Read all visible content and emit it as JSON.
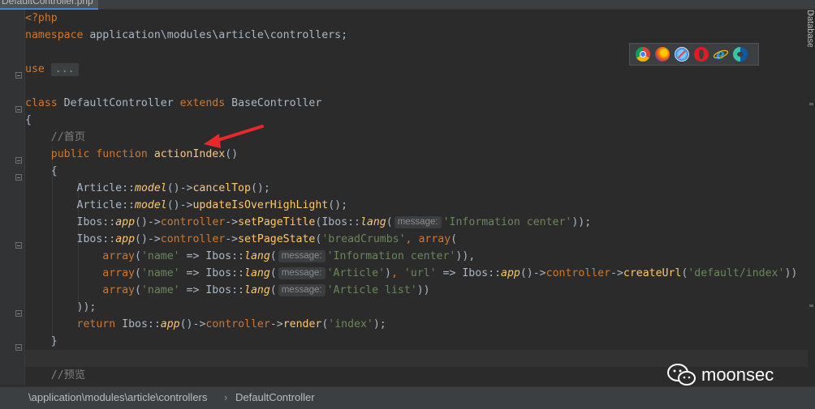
{
  "file_tab": {
    "label": "DefaultController.php"
  },
  "side_panel": {
    "label": "Database"
  },
  "code": {
    "php_open": "<?php",
    "namespace_kw": "namespace",
    "namespace_path": "application\\modules\\article\\controllers;",
    "use_kw": "use",
    "use_folded": "...",
    "class_kw": "class",
    "class_name": "DefaultController",
    "extends_kw": "extends",
    "parent_class": "BaseController",
    "brace_open": "{",
    "brace_close": "}",
    "comment_home": "//首页",
    "public_kw": "public",
    "function_kw": "function",
    "method_name": "actionIndex",
    "method_parens": "()",
    "article_cls": "Article",
    "dcolon": "::",
    "model_fn": "model",
    "arrow": "->",
    "cancel_top": "cancelTop",
    "update_over": "updateIsOverHighLight",
    "call_end": "();",
    "paren_open": "(",
    "paren_close": ")",
    "ibos_cls": "Ibos",
    "app_fn": "app",
    "controller_prop": "controller",
    "set_title_fn": "setPageTitle",
    "lang_fn": "lang",
    "hint_message": "message:",
    "str_info_center": "'Information center'",
    "close_2": "));",
    "set_state_fn": "setPageState",
    "str_breadcrumbs": "'breadCrumbs'",
    "comma": ", ",
    "array_kw": "array",
    "str_name": "'name'",
    "fat_arrow": " => ",
    "close_comma": ")),",
    "str_article": "'Article'",
    "str_url": "'url'",
    "create_url_fn": "createUrl",
    "str_default_index": "'default/index'",
    "close_3": "))",
    "str_article_list": "'Article list'",
    "close_1": "))",
    "close_stmt": "));",
    "return_kw": "return",
    "render_fn": "render",
    "str_index": "'index'",
    "close_render": ");",
    "comment_preview": "//预览"
  },
  "browser_icons": [
    "chrome-icon",
    "firefox-icon",
    "safari-icon",
    "opera-icon",
    "ie-icon",
    "edge-icon"
  ],
  "watermark": {
    "text": "moonsec"
  },
  "breadcrumb": {
    "path": "\\application\\modules\\article\\controllers",
    "separator": "›",
    "class": "DefaultController"
  },
  "colors": {
    "background": "#2b2b2b",
    "keyword": "#cc7832",
    "function": "#ffc66d",
    "string": "#6a8759",
    "comment": "#808080",
    "text": "#a9b7c6",
    "arrow": "#e8292b"
  }
}
